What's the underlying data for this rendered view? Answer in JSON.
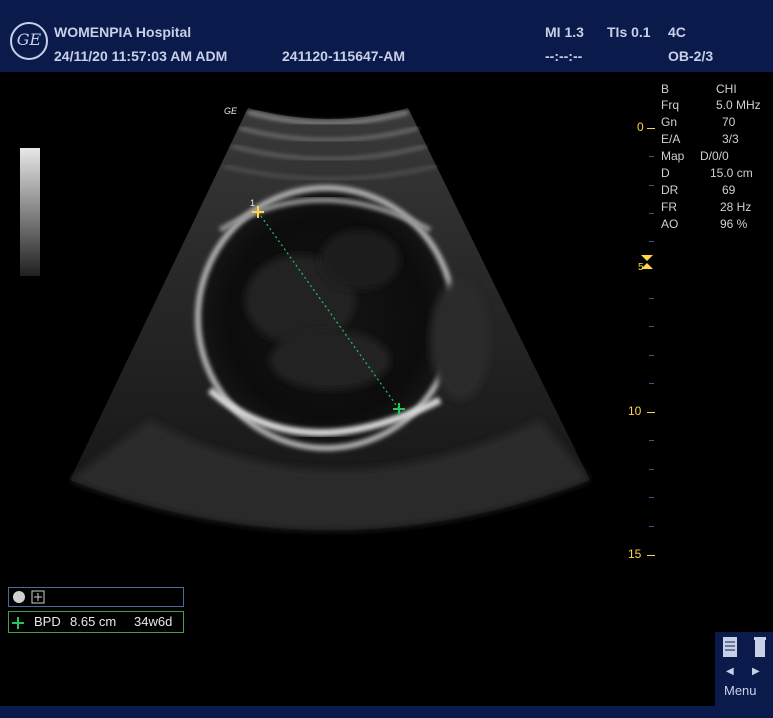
{
  "header": {
    "hospital": "WOMENPIA Hospital",
    "datetime": "24/11/20 11:57:03 AM ADM",
    "patient_id": "241120-115647-AM",
    "mi": "MI 1.3",
    "tis": "TIs 0.1",
    "probe": "4C",
    "cine": "--:--:--",
    "preset": "OB-2/3",
    "logo_text": "GE"
  },
  "image_params": [
    {
      "label": "B",
      "value": "CHI"
    },
    {
      "label": "Frq",
      "value": "5.0 MHz"
    },
    {
      "label": "Gn",
      "value": "70"
    },
    {
      "label": "E/A",
      "value": "3/3"
    },
    {
      "label": "Map",
      "value": "D/0/0"
    },
    {
      "label": "D",
      "value": "15.0 cm"
    },
    {
      "label": "DR",
      "value": "69"
    },
    {
      "label": "FR",
      "value": "28 Hz"
    },
    {
      "label": "AO",
      "value": "96 %"
    }
  ],
  "depth_scale": {
    "labels": [
      "0",
      "5",
      "10",
      "15"
    ],
    "unit": "cm"
  },
  "probe_orientation_mark": "GE",
  "caliper_label": "1",
  "measurement": {
    "label": "BPD",
    "value": "8.65 cm",
    "gestational_age": "34w6d"
  },
  "menu": {
    "label": "Menu"
  },
  "colors": {
    "header_bg": "#0a1a4a",
    "caliper": "#ffd54a",
    "caliper_end": "#22c55e",
    "depth_scale": "#ffd54a"
  }
}
